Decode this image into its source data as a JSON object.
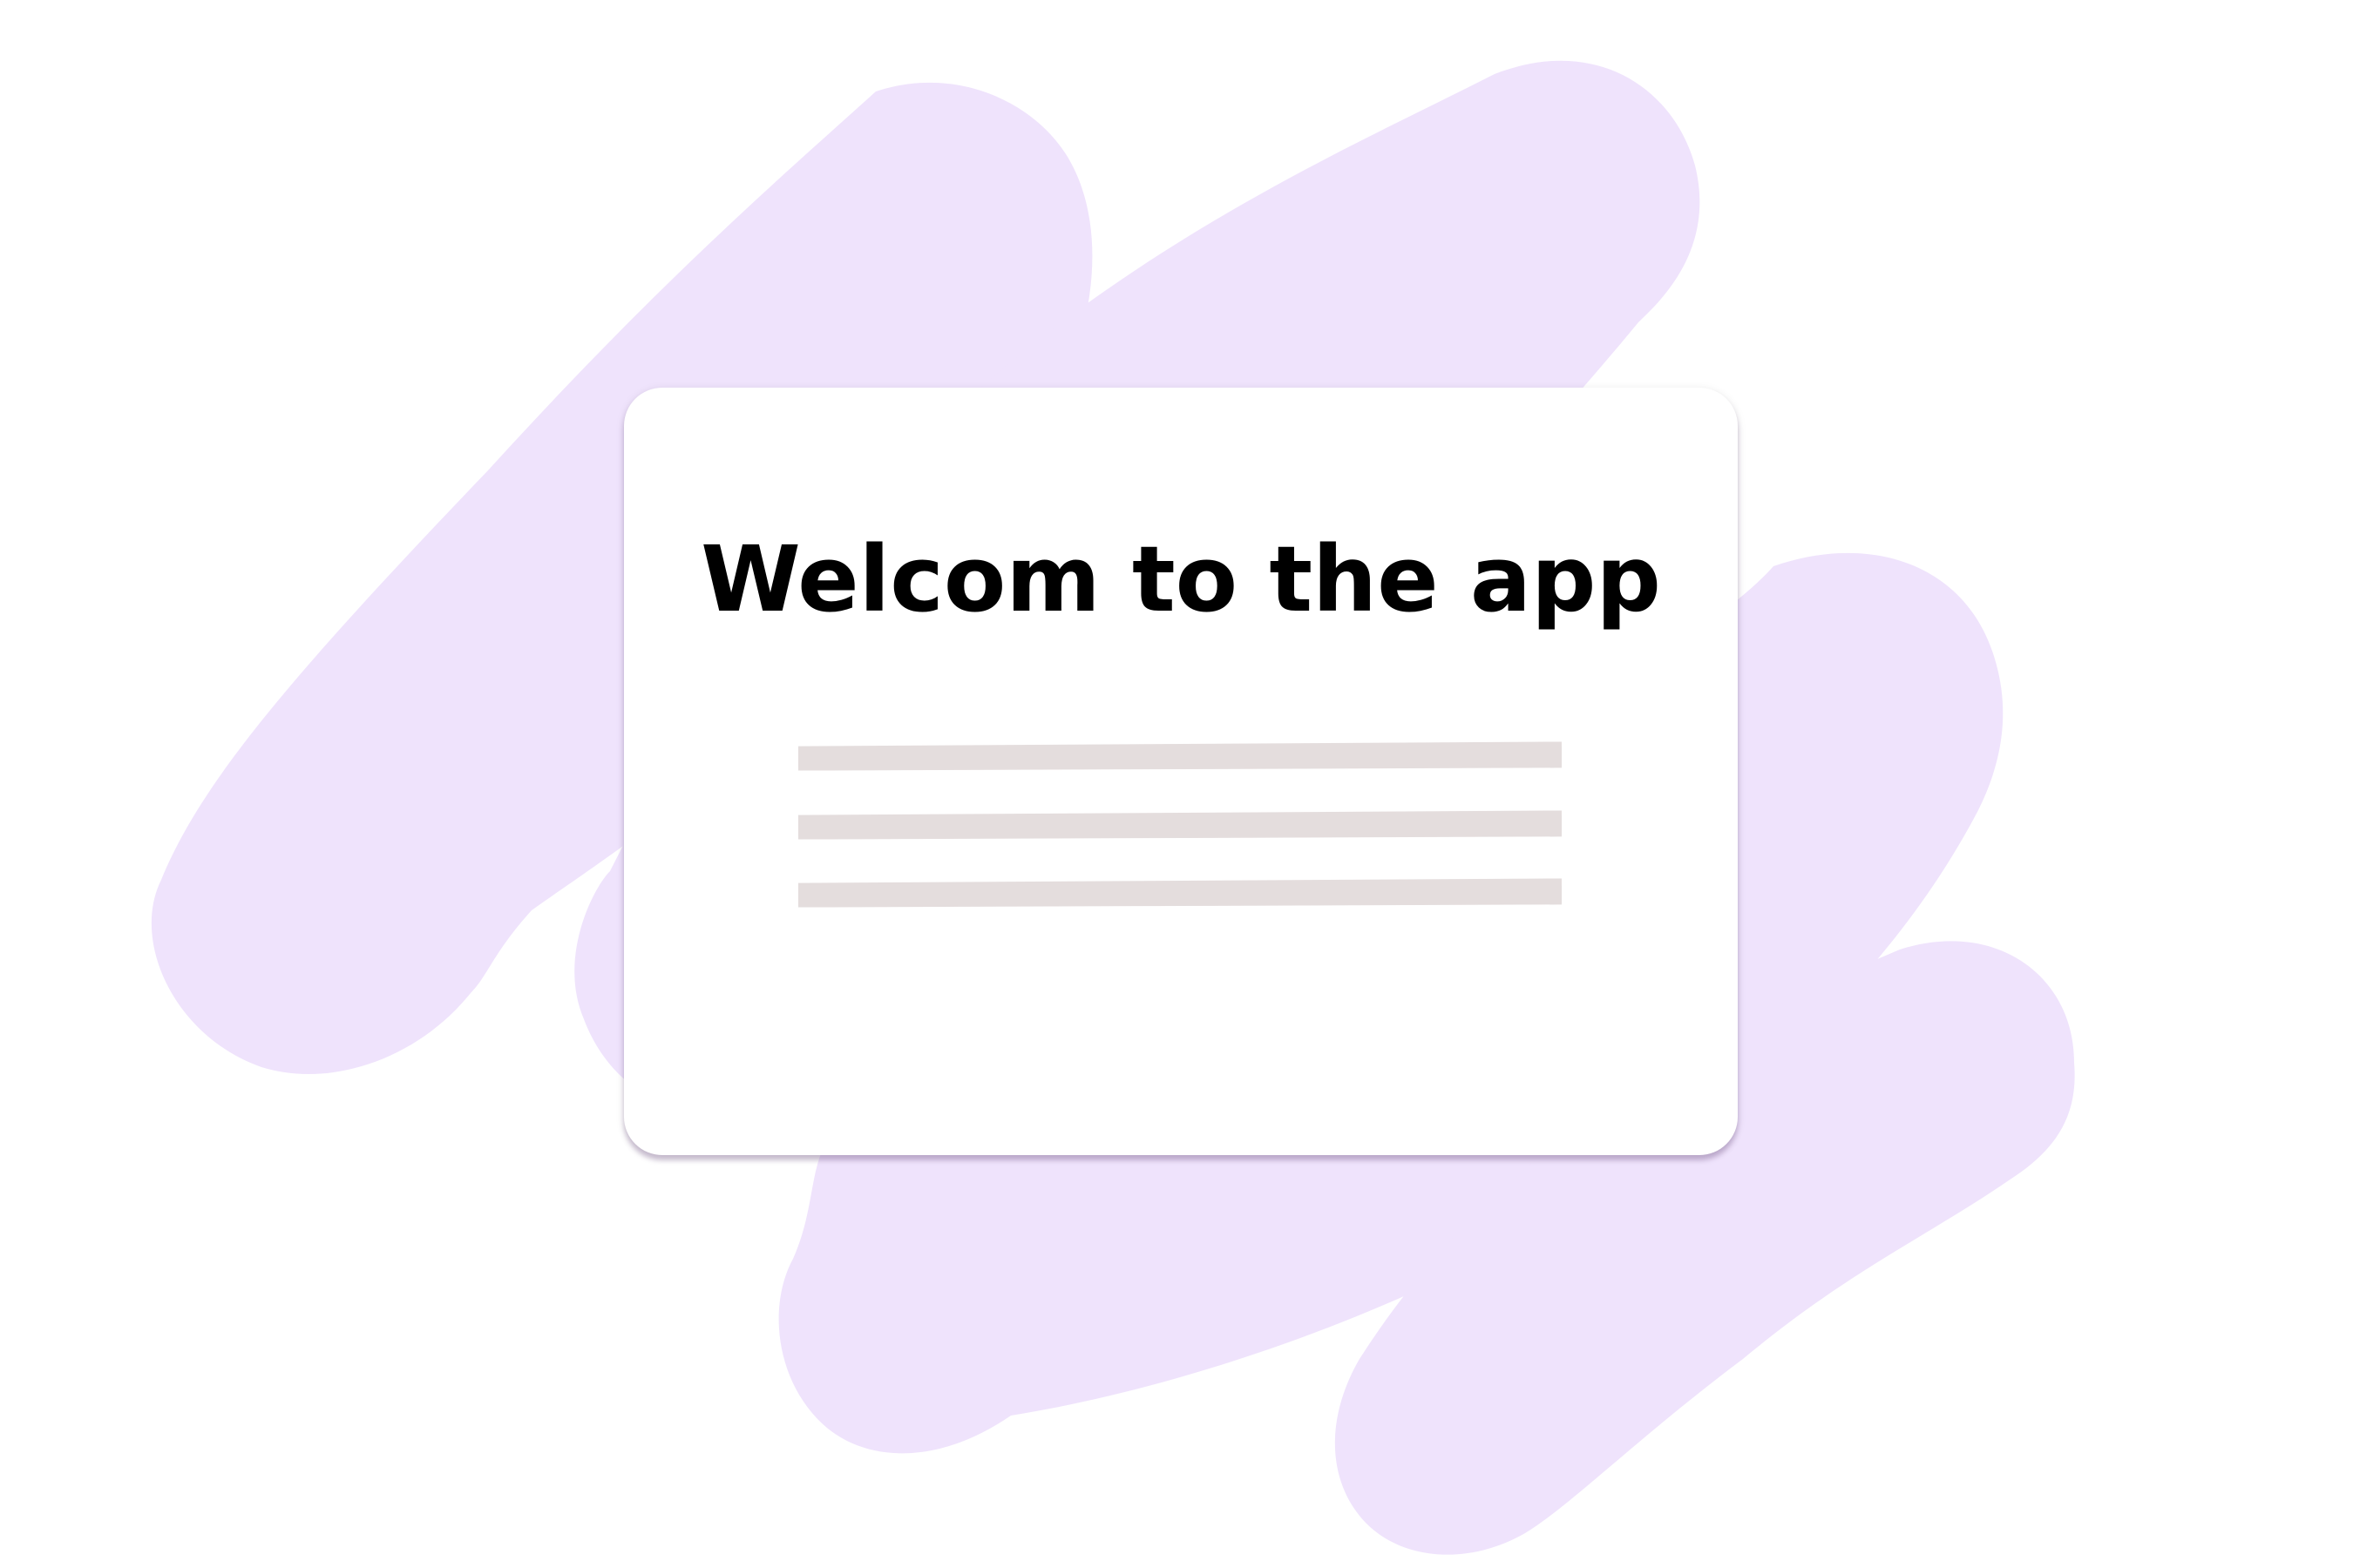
{
  "card": {
    "title": "Welcom to the app"
  },
  "colors": {
    "background": "#ffffff",
    "blob": "#efe3fc",
    "card": "#ffffff",
    "title_text": "#000000",
    "placeholder_line": "#e4dddd"
  },
  "placeholder_lines": 3
}
